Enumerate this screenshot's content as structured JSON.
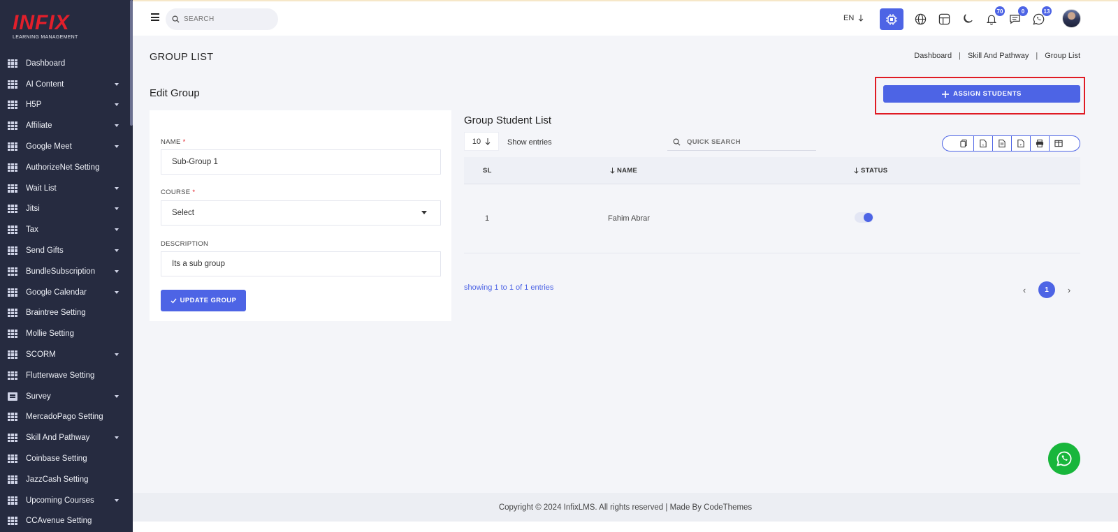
{
  "brand": {
    "name": "INFIX",
    "tagline": "LEARNING MANAGEMENT"
  },
  "sidebar": {
    "items": [
      {
        "label": "Dashboard",
        "icon": "grid-icon",
        "expandable": false
      },
      {
        "label": "AI Content",
        "icon": "grid-icon",
        "expandable": true
      },
      {
        "label": "H5P",
        "icon": "grid-icon",
        "expandable": true
      },
      {
        "label": "Affiliate",
        "icon": "grid-icon",
        "expandable": true
      },
      {
        "label": "Google Meet",
        "icon": "grid-icon",
        "expandable": true
      },
      {
        "label": "AuthorizeNet Setting",
        "icon": "grid-icon",
        "expandable": false
      },
      {
        "label": "Wait List",
        "icon": "grid-icon",
        "expandable": true
      },
      {
        "label": "Jitsi",
        "icon": "grid-icon",
        "expandable": true
      },
      {
        "label": "Tax",
        "icon": "grid-icon",
        "expandable": true
      },
      {
        "label": "Send Gifts",
        "icon": "grid-icon",
        "expandable": true
      },
      {
        "label": "BundleSubscription",
        "icon": "grid-icon",
        "expandable": true
      },
      {
        "label": "Google Calendar",
        "icon": "grid-icon",
        "expandable": true
      },
      {
        "label": "Braintree Setting",
        "icon": "grid-icon",
        "expandable": false
      },
      {
        "label": "Mollie Setting",
        "icon": "grid-icon",
        "expandable": false
      },
      {
        "label": "SCORM",
        "icon": "grid-icon",
        "expandable": true
      },
      {
        "label": "Flutterwave Setting",
        "icon": "grid-icon",
        "expandable": false
      },
      {
        "label": "Survey",
        "icon": "document-icon",
        "expandable": true
      },
      {
        "label": "MercadoPago Setting",
        "icon": "grid-icon",
        "expandable": false
      },
      {
        "label": "Skill And Pathway",
        "icon": "grid-icon",
        "expandable": true
      },
      {
        "label": "Coinbase Setting",
        "icon": "grid-icon",
        "expandable": false
      },
      {
        "label": "JazzCash Setting",
        "icon": "grid-icon",
        "expandable": false
      },
      {
        "label": "Upcoming Courses",
        "icon": "grid-icon",
        "expandable": true
      },
      {
        "label": "CCAvenue Setting",
        "icon": "grid-icon",
        "expandable": false
      }
    ]
  },
  "topbar": {
    "search_placeholder": "SEARCH",
    "language": "EN",
    "notifications_count": "70",
    "messages_count": "0",
    "whatsapp_count": "13"
  },
  "page": {
    "title": "GROUP LIST",
    "breadcrumb": [
      "Dashboard",
      "Skill And Pathway",
      "Group List"
    ],
    "breadcrumb_separator": "|",
    "section_title": "Edit Group",
    "assign_button": "ASSIGN STUDENTS"
  },
  "form": {
    "name_label": "NAME",
    "name_value": "Sub-Group 1",
    "course_label": "COURSE",
    "course_value": "Select",
    "description_label": "DESCRIPTION",
    "description_value": "Its a sub group",
    "required_mark": "*",
    "submit_label": "UPDATE GROUP"
  },
  "student_list": {
    "title": "Group Student List",
    "entries_value": "10",
    "show_entries_label": "Show entries",
    "quick_search_placeholder": "QUICK SEARCH",
    "columns": [
      "SL",
      "NAME",
      "STATUS"
    ],
    "rows": [
      {
        "sl": "1",
        "name": "Fahim Abrar",
        "status_active": true
      }
    ],
    "showing_text": "showing 1 to 1 of 1 entries",
    "current_page": "1",
    "export_buttons": [
      "copy-icon",
      "csv-icon",
      "excel-icon",
      "pdf-icon",
      "print-icon",
      "columns-icon"
    ]
  },
  "footer": {
    "text": "Copyright © 2024 InfixLMS. All rights reserved | Made By CodeThemes"
  },
  "colors": {
    "sidebar": "#262b40",
    "accent": "#4d64e5",
    "brand_red": "#e21f2b",
    "highlight": "#e01b24",
    "whatsapp": "#18b63c"
  }
}
